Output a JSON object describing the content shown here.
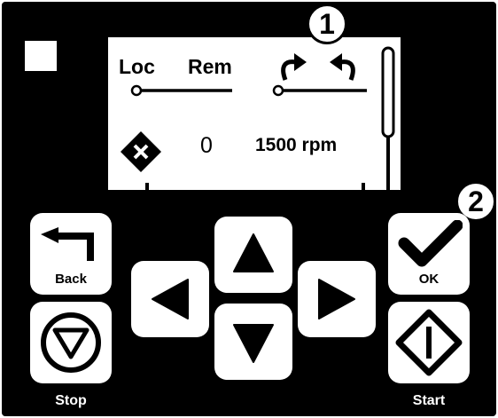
{
  "screen": {
    "loc_label": "Loc",
    "rem_label": "Rem",
    "value_zero": "0",
    "speed": "1500 rpm"
  },
  "buttons": {
    "back_label": "Back",
    "ok_label": "OK",
    "stop_label": "Stop",
    "start_label": "Start"
  },
  "badges": {
    "one": "1",
    "two": "2"
  },
  "icons": {
    "back": "back-arrow-icon",
    "ok": "checkmark-icon",
    "stop": "stop-triangle-icon",
    "start": "start-diamond-icon",
    "up": "arrow-up-icon",
    "down": "arrow-down-icon",
    "left": "arrow-left-icon",
    "right": "arrow-right-icon",
    "fault": "fault-x-icon",
    "direction": "rotation-arrows-icon"
  },
  "colors": {
    "panel": "#000000",
    "button": "#ffffff",
    "screen": "#ffffff"
  }
}
